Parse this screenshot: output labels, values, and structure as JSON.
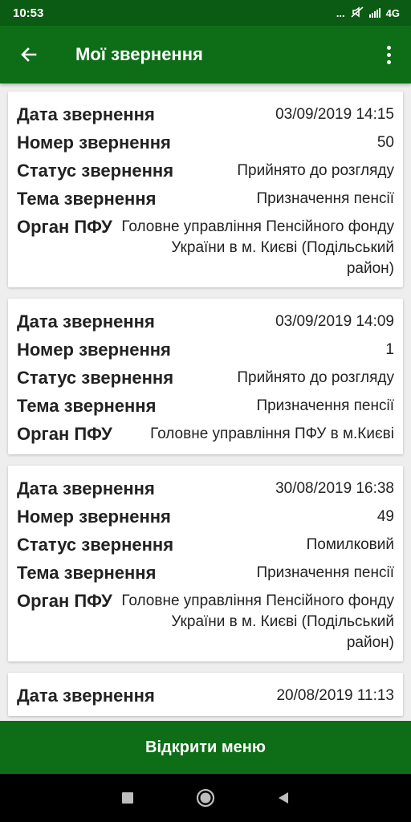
{
  "status_bar": {
    "time": "10:53",
    "dots": "...",
    "network": "4G"
  },
  "header": {
    "title": "Мої звернення",
    "back_icon": "arrow-left-icon",
    "menu_icon": "more-vert-icon"
  },
  "appeals": [
    {
      "fields": [
        {
          "label": "Дата звернення",
          "value": "03/09/2019 14:15"
        },
        {
          "label": "Номер звернення",
          "value": "50"
        },
        {
          "label": "Статус звернення",
          "value": "Прийнято до розгляду"
        },
        {
          "label": "Тема звернення",
          "value": "Призначення пенсії"
        },
        {
          "label": "Орган ПФУ",
          "value": "Головне управління Пенсійного фонду України в м. Києві (Подільський район)"
        }
      ]
    },
    {
      "fields": [
        {
          "label": "Дата звернення",
          "value": "03/09/2019 14:09"
        },
        {
          "label": "Номер звернення",
          "value": "1"
        },
        {
          "label": "Статус звернення",
          "value": "Прийнято до розгляду"
        },
        {
          "label": "Тема звернення",
          "value": "Призначення пенсії"
        },
        {
          "label": "Орган ПФУ",
          "value": "Головне управління ПФУ в м.Києві"
        }
      ]
    },
    {
      "fields": [
        {
          "label": "Дата звернення",
          "value": "30/08/2019 16:38"
        },
        {
          "label": "Номер звернення",
          "value": "49"
        },
        {
          "label": "Статус звернення",
          "value": "Помилковий"
        },
        {
          "label": "Тема звернення",
          "value": "Призначення пенсії"
        },
        {
          "label": "Орган ПФУ",
          "value": "Головне управління Пенсійного фонду України в м. Києві (Подільський район)"
        }
      ]
    },
    {
      "fields": [
        {
          "label": "Дата звернення",
          "value": "20/08/2019 11:13"
        }
      ]
    }
  ],
  "bottom_button": {
    "label": "Відкрити меню"
  },
  "colors": {
    "primary": "#0e6e17",
    "status_bar": "#0c5b14",
    "background": "#eeeeee"
  }
}
